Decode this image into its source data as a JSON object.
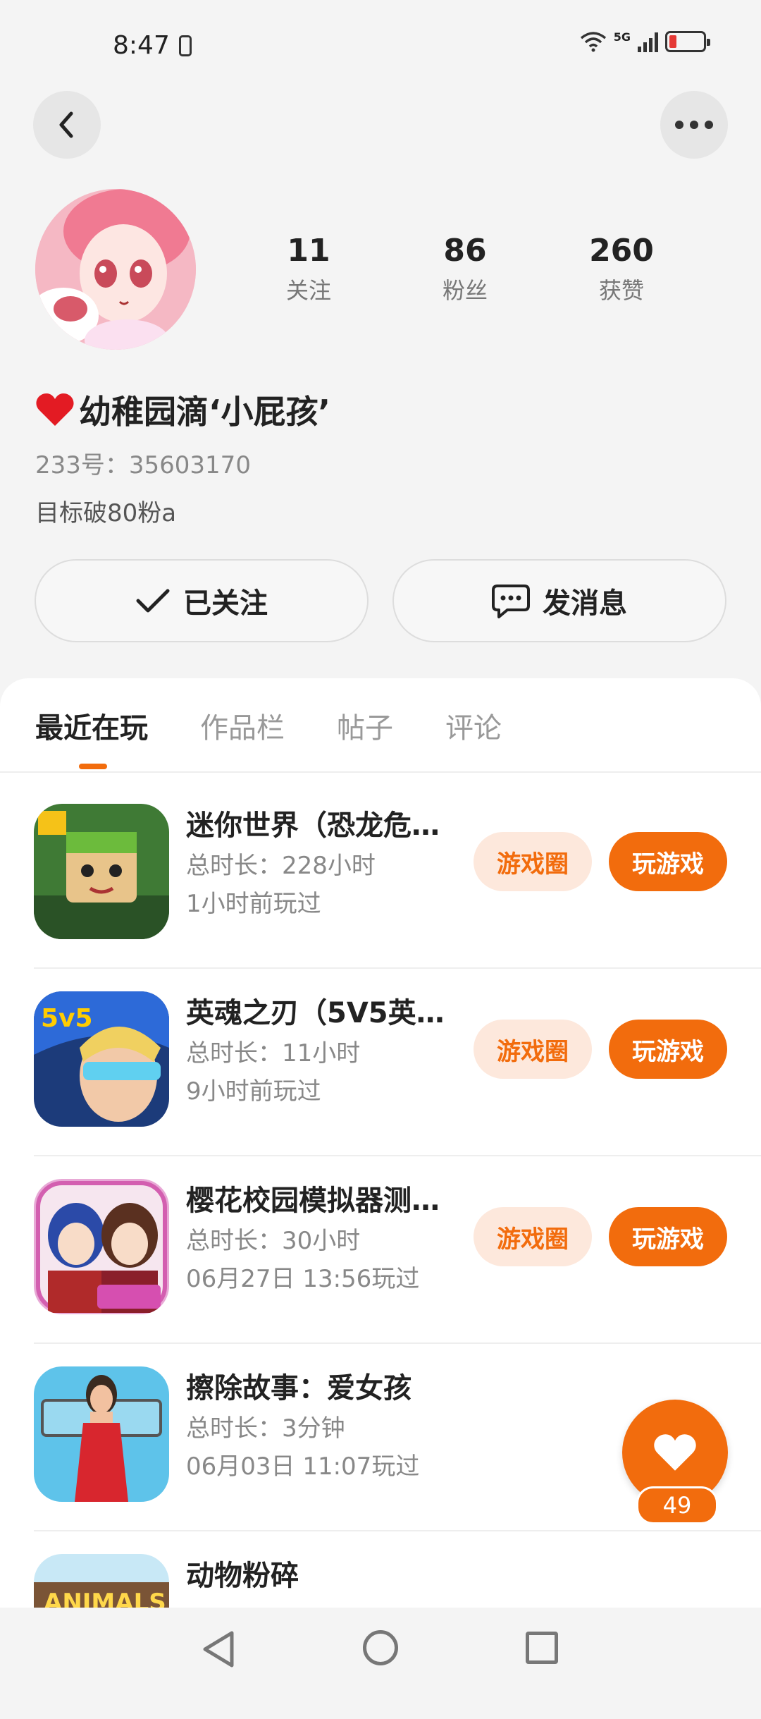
{
  "status_bar": {
    "time": "8:47",
    "network": "5G",
    "battery_level": 0.15
  },
  "header": {
    "back_icon": "chevron-left-icon",
    "more_icon": "more-dots-icon"
  },
  "profile": {
    "stats": [
      {
        "value": "11",
        "label": "关注"
      },
      {
        "value": "86",
        "label": "粉丝"
      },
      {
        "value": "260",
        "label": "获赞"
      }
    ],
    "nickname": "幼稚园滴‘小屁孩’",
    "uid": "233号：35603170",
    "bio": "目标破80粉a",
    "follow_label": "已关注",
    "message_label": "发消息"
  },
  "tabs": [
    {
      "label": "最近在玩",
      "active": true
    },
    {
      "label": "作品栏",
      "active": false
    },
    {
      "label": "帖子",
      "active": false
    },
    {
      "label": "评论",
      "active": false
    }
  ],
  "games": [
    {
      "title": "迷你世界（恐龙危…",
      "duration": "总时长：228小时",
      "last_played": "1小时前玩过",
      "circle_label": "游戏圈",
      "play_label": "玩游戏"
    },
    {
      "title": "英魂之刃（5V5英…",
      "duration": "总时长：11小时",
      "last_played": "9小时前玩过",
      "circle_label": "游戏圈",
      "play_label": "玩游戏"
    },
    {
      "title": "樱花校园模拟器测…",
      "duration": "总时长：30小时",
      "last_played": "06月27日 13:56玩过",
      "circle_label": "游戏圈",
      "play_label": "玩游戏"
    },
    {
      "title": "擦除故事：爱女孩",
      "duration": "总时长：3分钟",
      "last_played": "06月03日 11:07玩过"
    },
    {
      "title": "动物粉碎"
    }
  ],
  "floating_like": {
    "count": "49"
  },
  "colors": {
    "accent": "#f26c0d",
    "accent_light": "#fde8dc"
  }
}
